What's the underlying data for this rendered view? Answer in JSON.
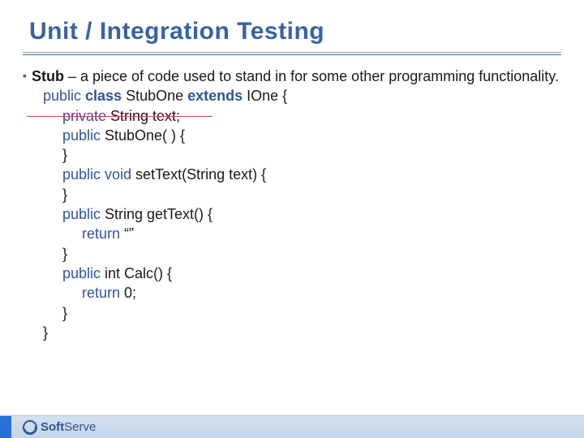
{
  "title": "Unit / Integration Testing",
  "definition": {
    "term": "Stub",
    "text": " – a piece of code used to stand in for some other programming functionality."
  },
  "code": {
    "l1a": "public",
    "l1b": "class",
    "l1c": " StubOne ",
    "l1d": "extends",
    "l1e": " IOne {",
    "l2a": "private",
    "l2b": " String text;",
    "l3a": "public",
    "l3b": " StubOne( ) {",
    "l4": "}",
    "l5a": "public",
    "l5b": "void",
    "l5c": " setText(String text) {",
    "l6": "}",
    "l7a": "public",
    "l7b": " String getText() {",
    "l8a": "return",
    "l8b": " “”",
    "l9": "}",
    "l10a": "public",
    "l10b": " int Calc() {",
    "l11a": "return",
    "l11b": " 0;",
    "l12": "}",
    "l13": "}"
  },
  "footer": {
    "brand_a": "Soft",
    "brand_b": "Serve"
  }
}
